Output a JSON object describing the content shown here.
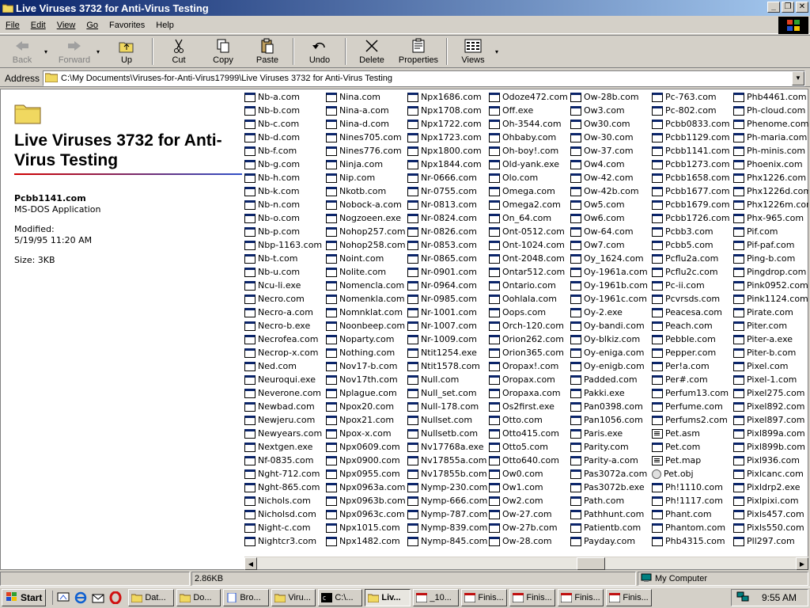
{
  "window": {
    "title": "Live Viruses 3732 for Anti-Virus Testing",
    "minimize": "_",
    "maximize": "❐",
    "close": "✕"
  },
  "menu": [
    "File",
    "Edit",
    "View",
    "Go",
    "Favorites",
    "Help"
  ],
  "toolbar": {
    "back": "Back",
    "forward": "Forward",
    "up": "Up",
    "cut": "Cut",
    "copy": "Copy",
    "paste": "Paste",
    "undo": "Undo",
    "delete": "Delete",
    "properties": "Properties",
    "views": "Views"
  },
  "address": {
    "label": "Address",
    "path": "C:\\My Documents\\Viruses-for-Anti-Virus17999\\Live Viruses 3732 for Anti-Virus Testing"
  },
  "panel": {
    "title": "Live Viruses 3732 for Anti-Virus Testing",
    "selected_name": "Pcbb1141.com",
    "selected_type": "MS-DOS Application",
    "modified_label": "Modified:",
    "modified_value": "5/19/95 11:20 AM",
    "size": "Size: 3KB"
  },
  "columns": [
    [
      "Nb-a.com",
      "Nb-b.com",
      "Nb-c.com",
      "Nb-d.com",
      "Nb-f.com",
      "Nb-g.com",
      "Nb-h.com",
      "Nb-k.com",
      "Nb-n.com",
      "Nb-o.com",
      "Nb-p.com",
      "Nbp-1163.com",
      "Nb-t.com",
      "Nb-u.com",
      "Ncu-li.exe",
      "Necro.com",
      "Necro-a.com",
      "Necro-b.exe",
      "Necrofea.com",
      "Necrop-x.com",
      "Ned.com",
      "Neuroqui.exe",
      "Neverone.com",
      "Newbad.com",
      "Newjeru.com",
      "Newyears.com",
      "Nextgen.exe",
      "Nf-0835.com",
      "Nght-712.com",
      "Nght-865.com",
      "Nichols.com",
      "Nicholsd.com",
      "Night-c.com",
      "Nightcr3.com"
    ],
    [
      "Nina.com",
      "Nina-a.com",
      "Nina-d.com",
      "Nines705.com",
      "Nines776.com",
      "Ninja.com",
      "Nip.com",
      "Nkotb.com",
      "Nobock-a.com",
      "Nogzoeen.exe",
      "Nohop257.com",
      "Nohop258.com",
      "Noint.com",
      "Nolite.com",
      "Nomencla.com",
      "Nomenkla.com",
      "Nomnklat.com",
      "Noonbeep.com",
      "Noparty.com",
      "Nothing.com",
      "Nov17-b.com",
      "Nov17th.com",
      "Nplague.com",
      "Npox20.com",
      "Npox21.com",
      "Npox-x.com",
      "Npx0609.com",
      "Npx0900.com",
      "Npx0955.com",
      "Npx0963a.com",
      "Npx0963b.com",
      "Npx0963c.com",
      "Npx1015.com",
      "Npx1482.com"
    ],
    [
      "Npx1686.com",
      "Npx1708.com",
      "Npx1722.com",
      "Npx1723.com",
      "Npx1800.com",
      "Npx1844.com",
      "Nr-0666.com",
      "Nr-0755.com",
      "Nr-0813.com",
      "Nr-0824.com",
      "Nr-0826.com",
      "Nr-0853.com",
      "Nr-0865.com",
      "Nr-0901.com",
      "Nr-0964.com",
      "Nr-0985.com",
      "Nr-1001.com",
      "Nr-1007.com",
      "Nr-1009.com",
      "Ntit1254.exe",
      "Ntit1578.com",
      "Null.com",
      "Null_set.com",
      "Null-178.com",
      "Nullset.com",
      "Nullsetb.com",
      "Nv17768a.exe",
      "Nv17855a.com",
      "Nv17855b.com",
      "Nymp-230.com",
      "Nymp-666.com",
      "Nymp-787.com",
      "Nymp-839.com",
      "Nymp-845.com"
    ],
    [
      "Odoze472.com",
      "Off.exe",
      "Oh-3544.com",
      "Ohbaby.com",
      "Oh-boy!.com",
      "Old-yank.exe",
      "Olo.com",
      "Omega.com",
      "Omega2.com",
      "On_64.com",
      "Ont-0512.com",
      "Ont-1024.com",
      "Ont-2048.com",
      "Ontar512.com",
      "Ontario.com",
      "Oohlala.com",
      "Oops.com",
      "Orch-120.com",
      "Orion262.com",
      "Orion365.com",
      "Oropax!.com",
      "Oropax.com",
      "Oropaxa.com",
      "Os2first.exe",
      "Otto.com",
      "Otto415.com",
      "Otto5.com",
      "Otto640.com",
      "Ow0.com",
      "Ow1.com",
      "Ow2.com",
      "Ow-27.com",
      "Ow-27b.com",
      "Ow-28.com"
    ],
    [
      "Ow-28b.com",
      "Ow3.com",
      "Ow30.com",
      "Ow-30.com",
      "Ow-37.com",
      "Ow4.com",
      "Ow-42.com",
      "Ow-42b.com",
      "Ow5.com",
      "Ow6.com",
      "Ow-64.com",
      "Ow7.com",
      "Oy_1624.com",
      "Oy-1961a.com",
      "Oy-1961b.com",
      "Oy-1961c.com",
      "Oy-2.exe",
      "Oy-bandi.com",
      "Oy-blkiz.com",
      "Oy-eniga.com",
      "Oy-enigb.com",
      "Padded.com",
      "Pakki.exe",
      "Pan0398.com",
      "Pan1056.com",
      "Paris.exe",
      "Parity.com",
      "Parity-a.com",
      "Pas3072a.com",
      "Pas3072b.exe",
      "Path.com",
      "Pathhunt.com",
      "Patientb.com",
      "Payday.com"
    ],
    [
      "Pc-763.com",
      "Pc-802.com",
      "Pcbb0833.com",
      "Pcbb1129.com",
      "Pcbb1141.com",
      "Pcbb1273.com",
      "Pcbb1658.com",
      "Pcbb1677.com",
      "Pcbb1679.com",
      "Pcbb1726.com",
      "Pcbb3.com",
      "Pcbb5.com",
      "Pcflu2a.com",
      "Pcflu2c.com",
      "Pc-ii.com",
      "Pcvrsds.com",
      "Peacesa.com",
      "Peach.com",
      "Pebble.com",
      "Pepper.com",
      "Per!a.com",
      "Per#.com",
      "Perfum13.com",
      "Perfume.com",
      "Perfums2.com",
      "Pet.asm",
      "Pet.com",
      "Pet.map",
      "Pet.obj",
      "Ph!1110.com",
      "Ph!1117.com",
      "Phant.com",
      "Phantom.com",
      "Phb4315.com"
    ],
    [
      "Phb4461.com",
      "Ph-cloud.com",
      "Phenome.com",
      "Ph-maria.com",
      "Ph-minis.com",
      "Phoenix.com",
      "Phx1226.com",
      "Phx1226d.com",
      "Phx1226m.com",
      "Phx-965.com",
      "Pif.com",
      "Pif-paf.com",
      "Ping-b.com",
      "Pingdrop.com",
      "Pink0952.com",
      "Pink1124.com",
      "Pirate.com",
      "Piter.com",
      "Piter-a.exe",
      "Piter-b.com",
      "Pixel.com",
      "Pixel-1.com",
      "Pixel275.com",
      "Pixel892.com",
      "Pixel897.com",
      "Pixl899a.com",
      "Pixl899b.com",
      "Pixl936.com",
      "Pixlcanc.com",
      "Pixldrp2.exe",
      "Pixlpixi.com",
      "Pixls457.com",
      "Pixls550.com",
      "Pll297.com"
    ]
  ],
  "status": {
    "size": "2.86KB",
    "zone": "My Computer"
  },
  "taskbar": {
    "start": "Start",
    "tasks": [
      "Dat...",
      "Do...",
      "Bro...",
      "Viru...",
      "C:\\...",
      "Liv...",
      "_10...",
      "Finis...",
      "Finis...",
      "Finis...",
      "Finis..."
    ],
    "clock": "9:55 AM"
  }
}
